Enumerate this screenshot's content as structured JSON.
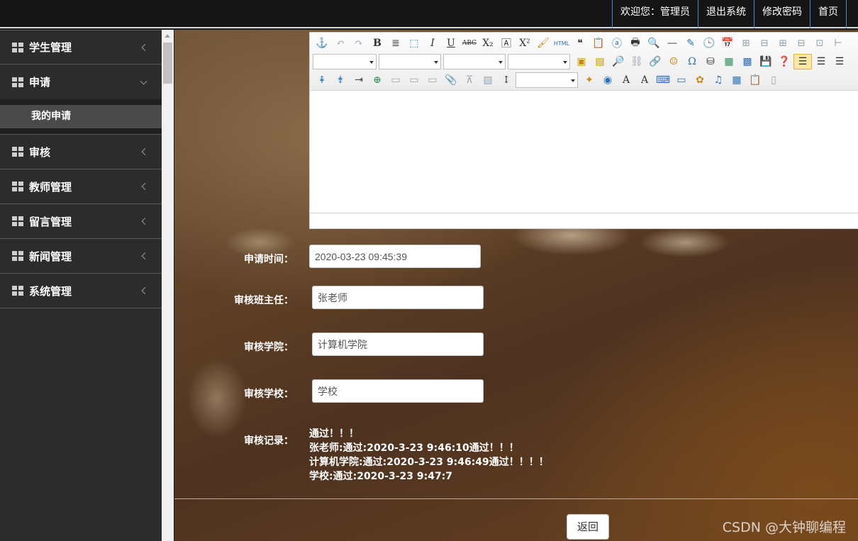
{
  "topnav": {
    "welcome": "欢迎您：管理员",
    "logout": "退出系统",
    "change_password": "修改密码",
    "home": "首页"
  },
  "sidebar": {
    "items": [
      {
        "label": "学生管理",
        "state": "collapsed"
      },
      {
        "label": "申请",
        "state": "expanded",
        "children": [
          "我的申请"
        ]
      },
      {
        "label": "审核",
        "state": "collapsed"
      },
      {
        "label": "教师管理",
        "state": "collapsed"
      },
      {
        "label": "留言管理",
        "state": "collapsed"
      },
      {
        "label": "新闻管理",
        "state": "collapsed"
      },
      {
        "label": "系统管理",
        "state": "collapsed"
      }
    ]
  },
  "editor": {
    "toolbar_icons": [
      "anchor-icon",
      "undo-icon",
      "redo-icon",
      "bold-icon",
      "strikethrough-icon",
      "italic-icon",
      "underline-icon",
      "superscript-icon",
      "subscript-icon",
      "html-icon",
      "quote-icon",
      "print-icon",
      "search-icon",
      "table-icon",
      "paste-icon",
      "align-left-icon",
      "align-right-icon",
      "align-center-icon"
    ],
    "html_label": "HTML"
  },
  "form": {
    "apply_time": {
      "label": "申请时间：",
      "value": "2020-03-23 09:45:39"
    },
    "teacher": {
      "label": "审核班主任：",
      "value": "张老师"
    },
    "college": {
      "label": "审核学院：",
      "value": "计算机学院"
    },
    "school": {
      "label": "审核学校：",
      "value": "学校"
    },
    "record": {
      "label": "审核记录：",
      "lines": [
        "通过！！！",
        "张老师:通过:2020-3-23 9:46:10通过！！！",
        "计算机学院:通过:2020-3-23 9:46:49通过！！！！",
        "学校:通过:2020-3-23 9:47:7"
      ]
    }
  },
  "back_button": "返回",
  "watermark": "CSDN @大钟聊编程"
}
